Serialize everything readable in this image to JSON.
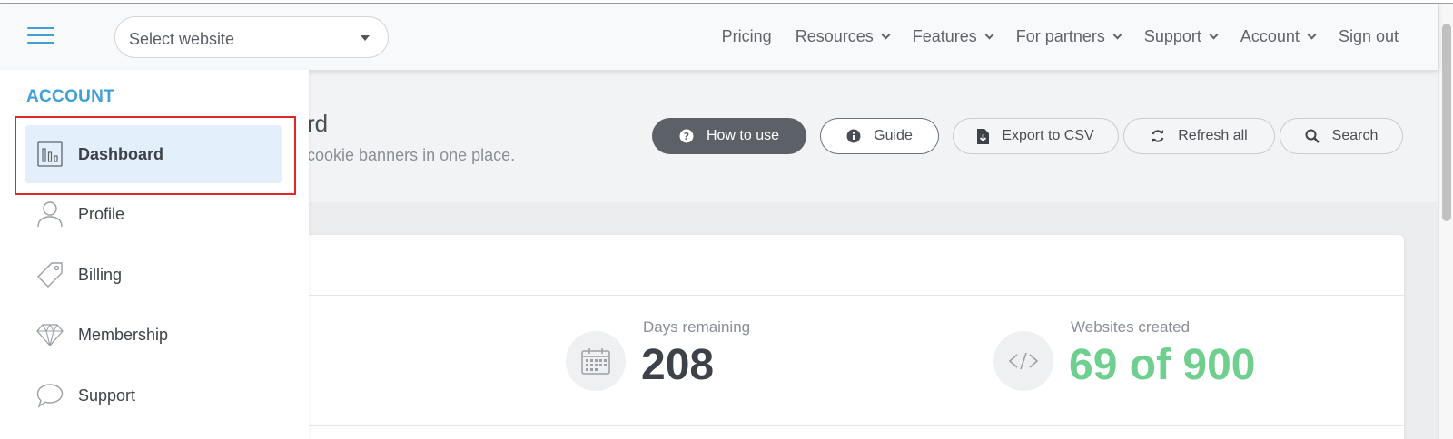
{
  "header": {
    "select": {
      "value": "Select website"
    },
    "nav": [
      {
        "label": "Pricing",
        "dropdown": false
      },
      {
        "label": "Resources",
        "dropdown": true
      },
      {
        "label": "Features",
        "dropdown": true
      },
      {
        "label": "For partners",
        "dropdown": true
      },
      {
        "label": "Support",
        "dropdown": true
      },
      {
        "label": "Account",
        "dropdown": true
      },
      {
        "label": "Sign out",
        "dropdown": false
      }
    ]
  },
  "hero": {
    "title_partial": "rd",
    "subtitle_partial": "cookie banners in one place.",
    "buttons": {
      "how_to_use": "How to use",
      "guide": "Guide",
      "export_csv": "Export to CSV",
      "refresh_all": "Refresh all",
      "search": "Search"
    }
  },
  "stats": {
    "days_remaining": {
      "label": "Days remaining",
      "value": "208",
      "icon": "calendar-icon"
    },
    "websites_created": {
      "label": "Websites created",
      "value": "69 of 900",
      "icon": "code-icon"
    }
  },
  "sidebar": {
    "heading": "ACCOUNT",
    "items": [
      {
        "label": "Dashboard",
        "icon": "bar-chart-icon",
        "active": true
      },
      {
        "label": "Profile",
        "icon": "user-icon",
        "active": false
      },
      {
        "label": "Billing",
        "icon": "tag-icon",
        "active": false
      },
      {
        "label": "Membership",
        "icon": "diamond-icon",
        "active": false
      },
      {
        "label": "Support",
        "icon": "chat-bubble-icon",
        "active": false
      }
    ]
  },
  "colors": {
    "accent": "#3fa0d8",
    "active_bg": "#e3f0fb",
    "highlight": "#e0272a",
    "success": "#6fcf8e"
  }
}
